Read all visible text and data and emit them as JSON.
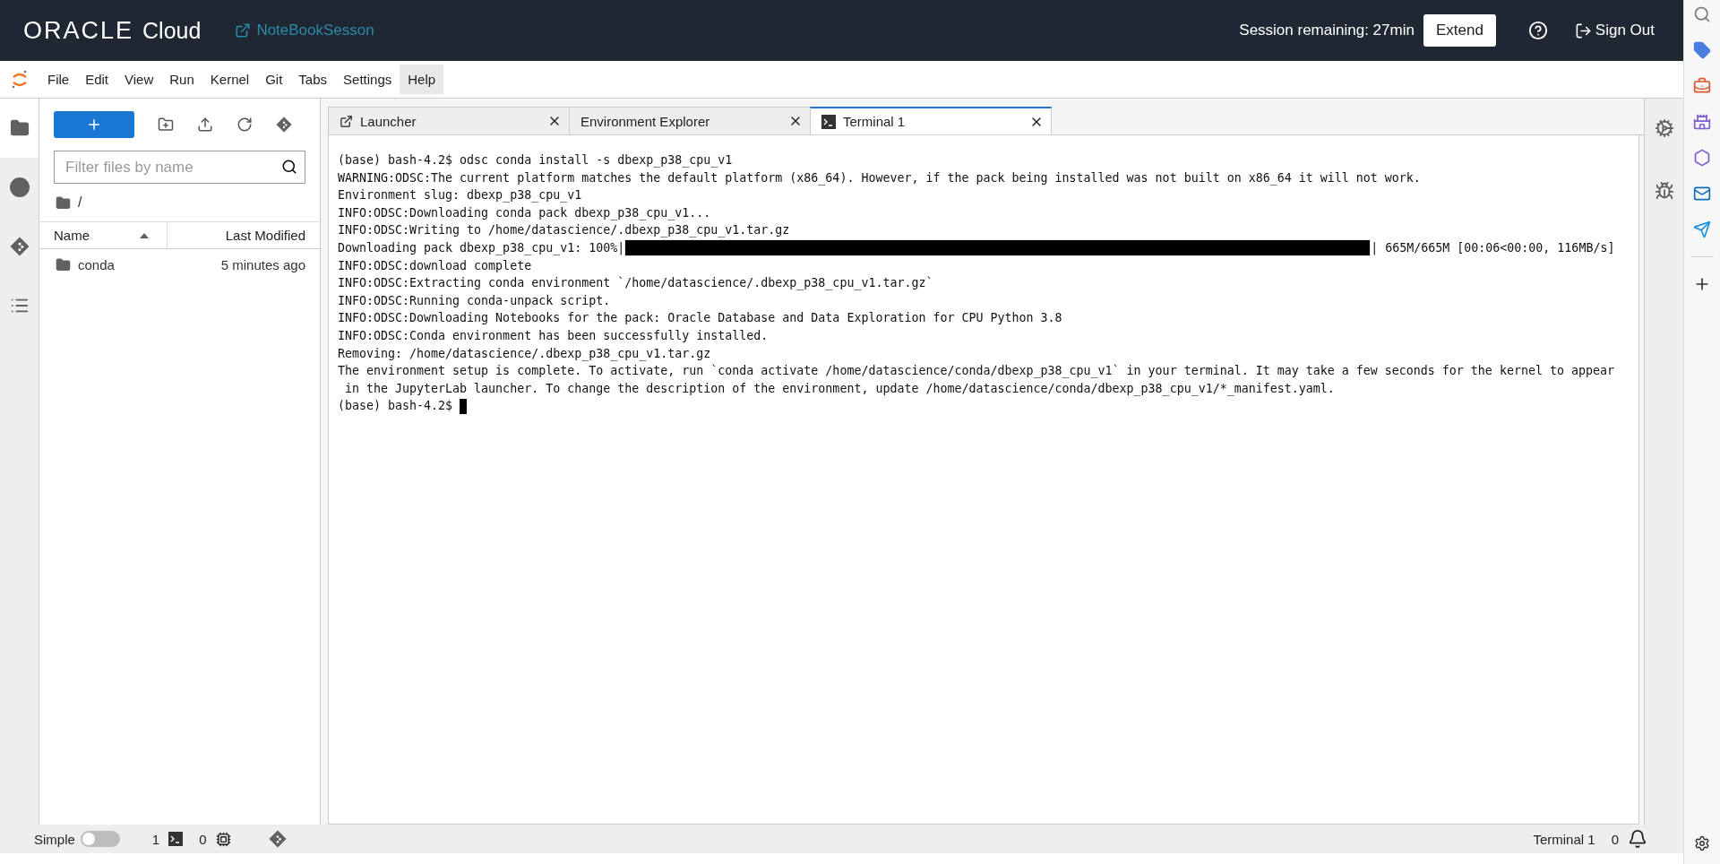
{
  "header": {
    "logo": "ORACLE",
    "product": "Cloud",
    "notebook": "NoteBookSesson",
    "session": "Session remaining: 27min",
    "extend": "Extend",
    "sign_out": "Sign Out"
  },
  "menu": [
    {
      "label": "File",
      "selected": false
    },
    {
      "label": "Edit",
      "selected": false
    },
    {
      "label": "View",
      "selected": false
    },
    {
      "label": "Run",
      "selected": false
    },
    {
      "label": "Kernel",
      "selected": false
    },
    {
      "label": "Git",
      "selected": false
    },
    {
      "label": "Tabs",
      "selected": false
    },
    {
      "label": "Settings",
      "selected": false
    },
    {
      "label": "Help",
      "selected": true
    }
  ],
  "activity_bar": [
    {
      "kind": "files",
      "selected": true
    },
    {
      "kind": "running",
      "selected": false
    },
    {
      "kind": "git",
      "selected": false
    },
    {
      "kind": "toc",
      "selected": false
    }
  ],
  "file_browser": {
    "filter_placeholder": "Filter files by name",
    "path": "/",
    "columns": [
      "Name",
      "Last Modified"
    ],
    "rows": [
      {
        "name": "conda",
        "modified": "5 minutes ago"
      }
    ]
  },
  "tabs": [
    {
      "label": "Launcher",
      "kind": "launcher",
      "selected": false
    },
    {
      "label": "Environment Explorer",
      "kind": "plain",
      "selected": false
    },
    {
      "label": "Terminal 1",
      "kind": "terminal",
      "selected": true
    }
  ],
  "terminal": {
    "lines": [
      {
        "kind": "text",
        "text": "(base) bash-4.2$ odsc conda install -s dbexp_p38_cpu_v1"
      },
      {
        "kind": "text",
        "text": "WARNING:ODSC:The current platform matches the default platform (x86_64). However, if the pack being installed was not built on x86_64 it will not work."
      },
      {
        "kind": "text",
        "text": "Environment slug: dbexp_p38_cpu_v1"
      },
      {
        "kind": "text",
        "text": "INFO:ODSC:Downloading conda pack dbexp_p38_cpu_v1..."
      },
      {
        "kind": "text",
        "text": "INFO:ODSC:Writing to /home/datascience/.dbexp_p38_cpu_v1.tar.gz"
      },
      {
        "kind": "progress",
        "prefix": "Downloading pack dbexp_p38_cpu_v1: 100%|",
        "level": 1,
        "suffix": "| 665M/665M [00:06<00:00, 116MB/s]"
      },
      {
        "kind": "text",
        "text": "INFO:ODSC:download complete"
      },
      {
        "kind": "text",
        "text": "INFO:ODSC:Extracting conda environment `/home/datascience/.dbexp_p38_cpu_v1.tar.gz`"
      },
      {
        "kind": "text",
        "text": "INFO:ODSC:Running conda-unpack script."
      },
      {
        "kind": "text",
        "text": "INFO:ODSC:Downloading Notebooks for the pack: Oracle Database and Data Exploration for CPU Python 3.8"
      },
      {
        "kind": "text",
        "text": "INFO:ODSC:Conda environment has been successfully installed."
      },
      {
        "kind": "text",
        "text": "Removing: /home/datascience/.dbexp_p38_cpu_v1.tar.gz"
      },
      {
        "kind": "text",
        "text": "The environment setup is complete. To activate, run `conda activate /home/datascience/conda/dbexp_p38_cpu_v1` in your terminal. It may take a few seconds for the kernel to appear"
      },
      {
        "kind": "text",
        "text": " in the JupyterLab launcher. To change the description of the environment, update /home/datascience/conda/dbexp_p38_cpu_v1/*_manifest.yaml."
      },
      {
        "kind": "prompt",
        "text": "(base) bash-4.2$ "
      }
    ]
  },
  "status_bar": {
    "mode": "Simple",
    "simple_on": false,
    "terminals": "1",
    "kernels": "0",
    "right_label": "Terminal 1",
    "notifications": "0"
  }
}
